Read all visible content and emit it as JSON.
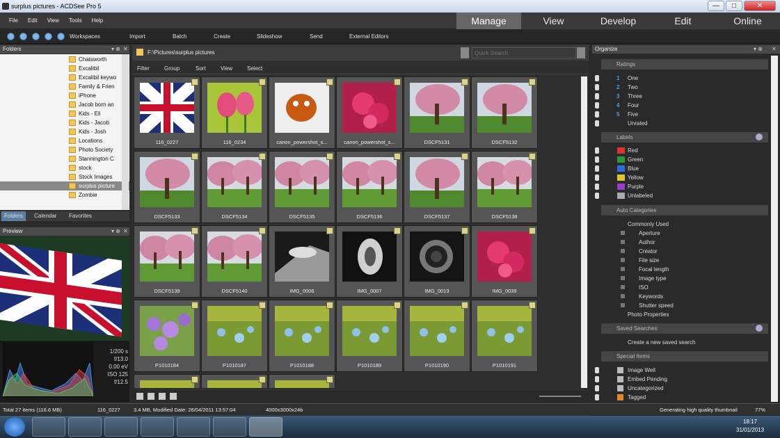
{
  "window": {
    "title": "surplus pictures - ACDSee Pro 5",
    "min": "—",
    "max": "□",
    "close": "✕"
  },
  "menu": [
    "File",
    "Edit",
    "View",
    "Tools",
    "Help"
  ],
  "modes": [
    {
      "label": "Manage",
      "active": true
    },
    {
      "label": "View",
      "active": false
    },
    {
      "label": "Develop",
      "active": false
    },
    {
      "label": "Edit",
      "active": false
    },
    {
      "label": "Online",
      "active": false
    }
  ],
  "toolbar": [
    "Workspaces",
    "Import",
    "Batch",
    "Create",
    "Slideshow",
    "Send",
    "External Editors"
  ],
  "folders": {
    "title": "Folders",
    "items": [
      "Chatsworth",
      "Excalibil",
      "Excalibil keywo",
      "Family & Frien",
      "iPhone",
      "Jacob born an",
      "Kids - Eli",
      "Kids - Jacob",
      "Kids - Josh",
      "Locations",
      "Photo Society",
      "Stannington C",
      "stock",
      "Stock Images",
      "surplus picture",
      "Zombie"
    ],
    "selected": 14,
    "tabs": [
      "Folders",
      "Calendar",
      "Favorites"
    ]
  },
  "preview": {
    "title": "Preview",
    "exif": [
      "1/200 s",
      "f/13.0",
      "0.00 eV",
      "ISO 125",
      "f/12.5"
    ]
  },
  "browser": {
    "path": "F:\\Pictures\\surplus pictures",
    "search_placeholder": "Quick Search",
    "filters": [
      "Filter",
      "Group",
      "Sort",
      "View",
      "Select"
    ],
    "thumbs": [
      {
        "name": "116_0227",
        "kind": "flag"
      },
      {
        "name": "116_0234",
        "kind": "tulip"
      },
      {
        "name": "canon_powershot_s...",
        "kind": "toy"
      },
      {
        "name": "canon_powershot_s...",
        "kind": "pink"
      },
      {
        "name": "DSCF5131",
        "kind": "tree"
      },
      {
        "name": "DSCF5132",
        "kind": "tree"
      },
      {
        "name": "DSCF5133",
        "kind": "tree"
      },
      {
        "name": "DSCF5134",
        "kind": "treewide"
      },
      {
        "name": "DSCF5135",
        "kind": "treewide"
      },
      {
        "name": "DSCF5136",
        "kind": "treewide"
      },
      {
        "name": "DSCF5137",
        "kind": "tree"
      },
      {
        "name": "DSCF5138",
        "kind": "treewide"
      },
      {
        "name": "DSCF5139",
        "kind": "treewide"
      },
      {
        "name": "DSCF5140",
        "kind": "treewide"
      },
      {
        "name": "IMG_0006",
        "kind": "bw"
      },
      {
        "name": "IMG_0007",
        "kind": "bw2"
      },
      {
        "name": "IMG_0013",
        "kind": "camera"
      },
      {
        "name": "IMG_0039",
        "kind": "pink"
      },
      {
        "name": "P1010184",
        "kind": "purple"
      },
      {
        "name": "P1010187",
        "kind": "green"
      },
      {
        "name": "P1010188",
        "kind": "green"
      },
      {
        "name": "P1010189",
        "kind": "green"
      },
      {
        "name": "P1010190",
        "kind": "green"
      },
      {
        "name": "P1010191",
        "kind": "green"
      },
      {
        "name": "",
        "kind": "green"
      },
      {
        "name": "",
        "kind": "green"
      },
      {
        "name": "",
        "kind": "green"
      }
    ]
  },
  "organize": {
    "title": "Organize",
    "ratings_title": "Ratings",
    "ratings": [
      {
        "n": "1",
        "label": "One"
      },
      {
        "n": "2",
        "label": "Two"
      },
      {
        "n": "3",
        "label": "Three"
      },
      {
        "n": "4",
        "label": "Four"
      },
      {
        "n": "5",
        "label": "Five"
      },
      {
        "n": "",
        "label": "Unrated"
      }
    ],
    "labels_title": "Labels",
    "labels": [
      {
        "label": "Red",
        "color": "#d33"
      },
      {
        "label": "Green",
        "color": "#2a9a3a"
      },
      {
        "label": "Blue",
        "color": "#2d6be0"
      },
      {
        "label": "Yellow",
        "color": "#e0c52a"
      },
      {
        "label": "Purple",
        "color": "#9b3bc9"
      },
      {
        "label": "Unlabeled",
        "color": "#aaa"
      }
    ],
    "auto_title": "Auto Categories",
    "commonly_used": "Commonly Used",
    "auto": [
      "Aperture",
      "Author",
      "Creator",
      "File size",
      "Focal length",
      "Image type",
      "ISO",
      "Keywords",
      "Shutter speed"
    ],
    "photo_props": "Photo Properties",
    "saved_title": "Saved Searches",
    "saved_create": "Create a new saved search",
    "special_title": "Special Items",
    "special": [
      "Image Well",
      "Embed Pending",
      "Uncategorized",
      "Tagged"
    ]
  },
  "status": {
    "total": "Total 27 items (116.6 MB)",
    "file": "116_0227",
    "info": "3.4 MB, Modified Date: 26/04/2011 13:57:04",
    "dims": "4000x3000x24b",
    "progress": "Generating high quality thumbnail",
    "zoom": "77%"
  },
  "taskbar": {
    "time": "18:17",
    "date": "31/01/2013"
  }
}
